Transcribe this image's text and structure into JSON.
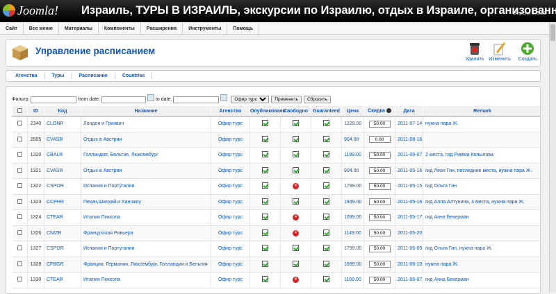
{
  "header": {
    "logo": "Joomla!",
    "site_title": "Израиль, ТУРЫ В ИЗРАИЛЬ, экскурсии по Израилю, отдых в Израиле, организованные",
    "version": "Версия 1.5.22"
  },
  "menu": [
    "Сайт",
    "Все меню",
    "Материалы",
    "Компоненты",
    "Расширения",
    "Инструменты",
    "Помощь"
  ],
  "toolbar": {
    "title": "Управление расписанием",
    "delete_label": "Удалить",
    "edit_label": "Изменить",
    "create_label": "Создать"
  },
  "tabs": [
    "Агенства",
    "Туры",
    "Расписание",
    "Countries"
  ],
  "filter": {
    "filter_label": "Фильтр:",
    "from_label": "from date:",
    "to_label": "to date:",
    "agency_selected": "Офир турс",
    "apply_label": "Применить",
    "reset_label": "Сбросить"
  },
  "columns": [
    "ID",
    "Код",
    "Название",
    "Агенство",
    "Опубликовано",
    "Свободно",
    "Guaranteed",
    "Цена",
    "Скидка",
    "Дата",
    "Remark"
  ],
  "rows": [
    {
      "id": "2340",
      "code": "CLONR",
      "name": "Лондон и Гринвич",
      "agency": "Офир турс",
      "published": "yes",
      "free": "yes",
      "guaranteed": "yes",
      "price": "1229.00",
      "discount": "50.00",
      "date": "2011-07-14",
      "remark": "нужна пара Ж."
    },
    {
      "id": "2505",
      "code": "CVASR",
      "name": "Отдых в Австрии",
      "agency": "Офир турс",
      "published": "yes",
      "free": "yes",
      "guaranteed": "yes",
      "price": "904.00",
      "discount": "0.00",
      "date": "2011-08-16",
      "remark": ""
    },
    {
      "id": "1320",
      "code": "CBALR",
      "name": "Голландия, Бельгия, Люксембург",
      "agency": "Офир турс",
      "published": "yes",
      "free": "yes",
      "guaranteed": "yes",
      "price": "1199.00",
      "discount": "50.00",
      "date": "2011-05-07",
      "remark": "2 места, гид Римма Копылова"
    },
    {
      "id": "1321",
      "code": "CVASR",
      "name": "Отдых в Австрии",
      "agency": "Офир турс",
      "published": "yes",
      "free": "yes",
      "guaranteed": "yes",
      "price": "904.00",
      "discount": "50.00",
      "date": "2011-05-16",
      "remark": "гид Леон Гин, последние места, нужна пара Ж."
    },
    {
      "id": "1322",
      "code": "CSPOR",
      "name": "Испания и Португалия",
      "agency": "Офир турс",
      "published": "yes",
      "free": "no",
      "guaranteed": "yes",
      "price": "1799.00",
      "discount": "50.00",
      "date": "2011-05-15",
      "remark": "гид Ольга Гин"
    },
    {
      "id": "1323",
      "code": "CCPHR",
      "name": "Пекин,Шанхай и Ханчжоу",
      "agency": "Офир турс",
      "published": "yes",
      "free": "yes",
      "guaranteed": "yes",
      "price": "1949.00",
      "discount": "50.00",
      "date": "2011-05-16",
      "remark": "гид Алла Алтунина, 4 места, нужна пара Ж."
    },
    {
      "id": "1324",
      "code": "CTEAR",
      "name": "Италия Пикхола",
      "agency": "Офир турс",
      "published": "yes",
      "free": "no",
      "guaranteed": "yes",
      "price": "1099.00",
      "discount": "50.00",
      "date": "2011-05-17",
      "remark": "гид Анна Бекерман"
    },
    {
      "id": "1326",
      "code": "CNIZR",
      "name": "Французская Ривьера",
      "agency": "Офир турс",
      "published": "yes",
      "free": "no",
      "guaranteed": "yes",
      "price": "1149.00",
      "discount": "50.00",
      "date": "2011-05-20",
      "remark": ""
    },
    {
      "id": "1327",
      "code": "CSPOR",
      "name": "Испания и Португалия",
      "agency": "Офир турс",
      "published": "yes",
      "free": "yes",
      "guaranteed": "yes",
      "price": "1799.00",
      "discount": "50.00",
      "date": "2011-06-05",
      "remark": "гид Ольга Гин, нужна пара Ж."
    },
    {
      "id": "1328",
      "code": "CFBGR",
      "name": "Франция, Германия, Люксембург, Голландия и Бельгия",
      "agency": "Офир турс",
      "published": "yes",
      "free": "yes",
      "guaranteed": "yes",
      "price": "1699.00",
      "discount": "50.00",
      "date": "2011-06-10",
      "remark": "нужна пара Ж."
    },
    {
      "id": "1330",
      "code": "CTEAR",
      "name": "Италия Пикхола",
      "agency": "Офир турс",
      "published": "yes",
      "free": "no",
      "guaranteed": "yes",
      "price": "1169.00",
      "discount": "50.00",
      "date": "2011-06-07",
      "remark": "гид Анна Бекерман"
    }
  ]
}
